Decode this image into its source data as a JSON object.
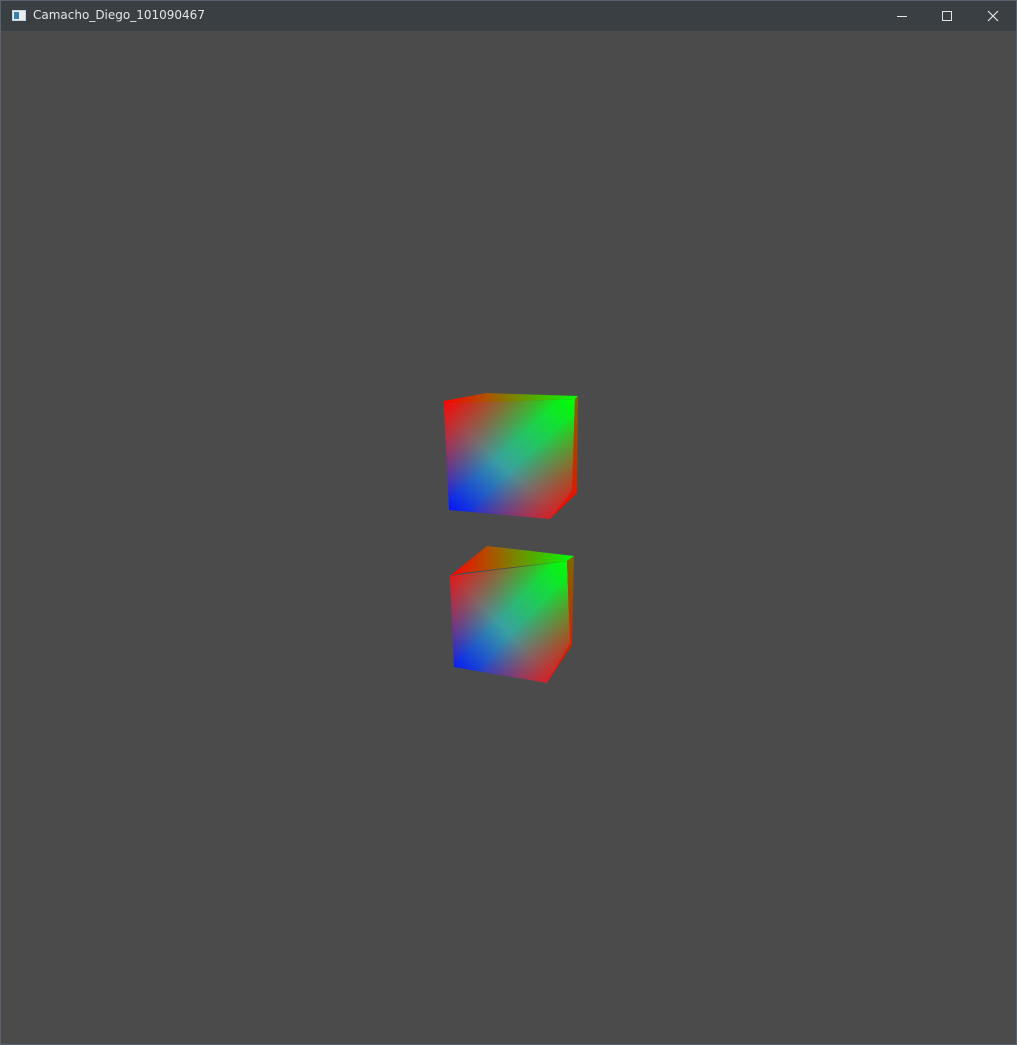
{
  "window": {
    "title": "Camacho_Diego_101090467",
    "background_color": "#4b4b4b",
    "titlebar_color": "#3a3f44"
  },
  "titlebar": {
    "app_icon": "window-app-icon",
    "minimize_icon": "minimize-icon",
    "maximize_icon": "maximize-icon",
    "close_icon": "close-icon"
  },
  "scene": {
    "objects": [
      {
        "name": "upper-cube",
        "type": "rgb-shaded-cube",
        "colors": [
          "#ff0000",
          "#00ff00",
          "#0000ff"
        ]
      },
      {
        "name": "lower-cube",
        "type": "rgb-shaded-cube",
        "colors": [
          "#ff0000",
          "#00ff00",
          "#0000ff"
        ]
      }
    ]
  }
}
